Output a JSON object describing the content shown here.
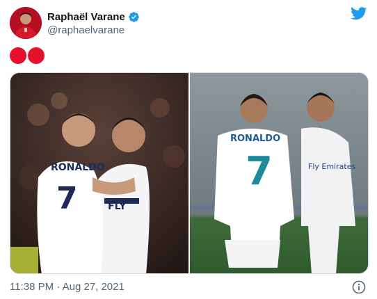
{
  "tweet": {
    "author": {
      "display_name": "Raphaël Varane",
      "handle": "@raphaelvarane",
      "verified": true,
      "avatar_icon": "avatar-photo"
    },
    "text_icons": [
      "red-circle-emoji",
      "red-circle-emoji"
    ],
    "media": {
      "count": 2,
      "photos": [
        {
          "name": "photo-left",
          "jersey_name": "RONALDO",
          "jersey_number": "7",
          "sponsor": "FLY",
          "icon": "football-players-photo"
        },
        {
          "name": "photo-right",
          "jersey_name": "RONALDO",
          "jersey_number": "7",
          "sponsor": "Fly Emirates",
          "icon": "football-players-photo"
        }
      ]
    },
    "timestamp": "11:38 PM · Aug 27, 2021",
    "icons": {
      "brand": "twitter-bird-icon",
      "verified": "verified-badge-icon",
      "info": "info-icon"
    },
    "colors": {
      "brand_blue": "#1d9bf0",
      "emoji_red": "#e8112d",
      "secondary_text": "#536471"
    }
  }
}
